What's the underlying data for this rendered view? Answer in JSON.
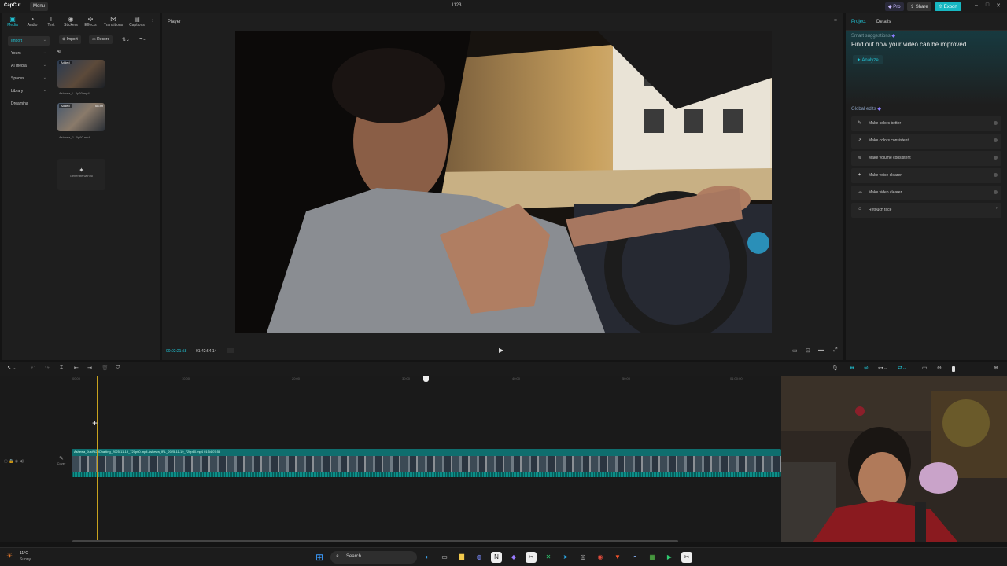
{
  "app": {
    "logo": "CapCut",
    "menu": "Menu",
    "title": "1123",
    "pro": "Pro",
    "share": "Share",
    "export": "Export"
  },
  "window_controls": [
    "–",
    "□",
    "✕"
  ],
  "top_tabs": [
    {
      "label": "Media",
      "icon": "media-icon",
      "glyph": "▣"
    },
    {
      "label": "Audio",
      "icon": "audio-icon",
      "glyph": "◔"
    },
    {
      "label": "Text",
      "icon": "text-icon",
      "glyph": "T"
    },
    {
      "label": "Stickers",
      "icon": "stickers-icon",
      "glyph": "◉"
    },
    {
      "label": "Effects",
      "icon": "effects-icon",
      "glyph": "✣"
    },
    {
      "label": "Transitions",
      "icon": "transitions-icon",
      "glyph": "⋈"
    },
    {
      "label": "Captions",
      "icon": "captions-icon",
      "glyph": "▤"
    }
  ],
  "side_categories": [
    "Import",
    "Yours",
    "AI media",
    "Spaces",
    "Library",
    "Dreamina"
  ],
  "media": {
    "import": "Import",
    "record": "Record",
    "all": "All",
    "items": [
      {
        "badge": "Added",
        "duration": "",
        "name": "Ashewa_I...0p60.mp4"
      },
      {
        "badge": "Added",
        "duration": "08:49",
        "name": "Ashewa_J...0p60.mp4"
      }
    ],
    "generate": "Generate with AI"
  },
  "player": {
    "title": "Player",
    "time_current": "00:02:21:58",
    "time_total": "01:42:54:14"
  },
  "right_panel": {
    "tabs": [
      "Project",
      "Details"
    ],
    "smart_title": "Smart suggestions",
    "smart_subtitle": "Find out how your video can be improved",
    "analyze": "Analyze",
    "global_title": "Global edits",
    "global_items": [
      {
        "label": "Make colors better",
        "icon": "color-wand-icon",
        "glyph": "✎"
      },
      {
        "label": "Make colors consistent",
        "icon": "color-consistent-icon",
        "glyph": "↗"
      },
      {
        "label": "Make volume consistent",
        "icon": "volume-icon",
        "glyph": "≋"
      },
      {
        "label": "Make voice clearer",
        "icon": "voice-icon",
        "glyph": "✦"
      },
      {
        "label": "Make video clearer",
        "icon": "hd-icon",
        "glyph": "HD"
      },
      {
        "label": "Retouch face",
        "icon": "face-icon",
        "glyph": "☺"
      }
    ]
  },
  "timeline": {
    "ruler": [
      "00:00",
      "10:00",
      "20:00",
      "30:00",
      "40:00",
      "50:00",
      "01:00:00"
    ],
    "cover": "Cover",
    "clip_label": "Ashewa_Just%20Chatting_2025-11-19_720p60.mp4   Ashewa_IRL_2025-11-19_720p60.mp4   01:54:07:55"
  },
  "taskbar": {
    "temp": "11°C",
    "weather": "Sunny",
    "search": "Search"
  }
}
